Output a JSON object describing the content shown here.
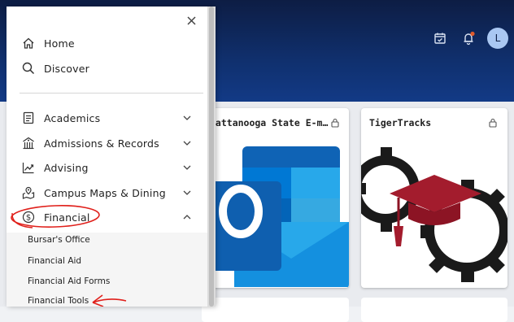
{
  "header": {
    "user_initial": "L"
  },
  "cards": [
    {
      "title": "hattanooga State E-m…"
    },
    {
      "title": "TigerTracks"
    }
  ],
  "menu": {
    "top_items": [
      {
        "label": "Home",
        "icon": "home-icon"
      },
      {
        "label": "Discover",
        "icon": "search-icon"
      }
    ],
    "sections": [
      {
        "label": "Academics",
        "icon": "document-icon",
        "expanded": false
      },
      {
        "label": "Admissions & Records",
        "icon": "building-icon",
        "expanded": false
      },
      {
        "label": "Advising",
        "icon": "trend-icon",
        "expanded": false
      },
      {
        "label": "Campus Maps & Dining",
        "icon": "map-icon",
        "expanded": false
      },
      {
        "label": "Financial",
        "icon": "dollar-icon",
        "expanded": true
      }
    ],
    "financial_sub_items": [
      {
        "label": "Bursar's Office"
      },
      {
        "label": "Financial Aid"
      },
      {
        "label": "Financial Aid Forms"
      },
      {
        "label": "Financial Tools"
      }
    ]
  },
  "colors": {
    "header_dark": "#0d1d44",
    "annotation_red": "#e0201b",
    "notification_dot": "#e05a2b",
    "outlook_blue": "#0f63b5",
    "gear_black": "#1a1a1a",
    "cap_red": "#a31c2d"
  }
}
